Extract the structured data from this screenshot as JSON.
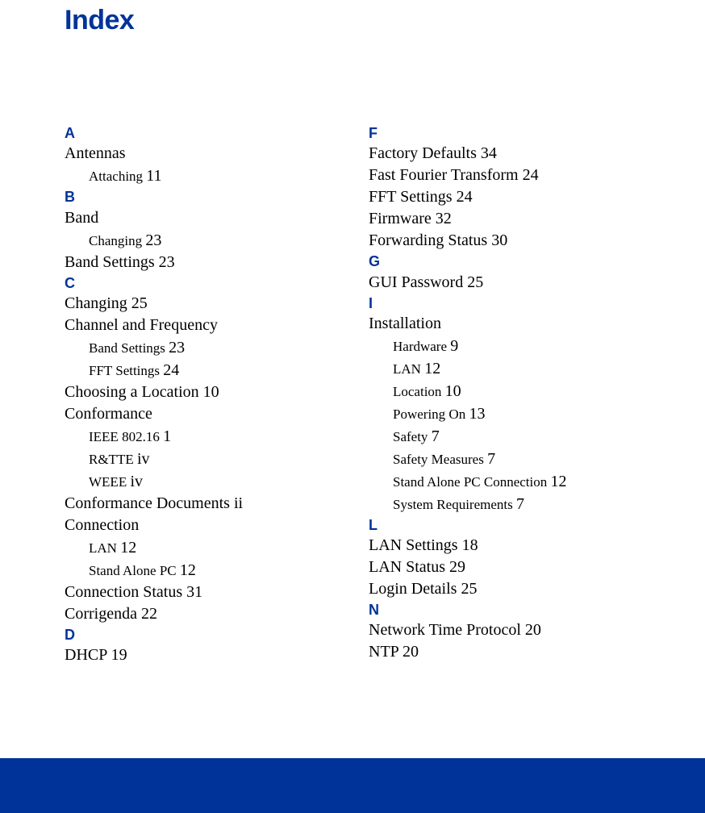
{
  "title": "Index",
  "columns": {
    "left": [
      {
        "kind": "letter",
        "text": "A"
      },
      {
        "kind": "entry",
        "text": "Antennas"
      },
      {
        "kind": "sub",
        "text": "Attaching",
        "page": "11"
      },
      {
        "kind": "letter",
        "text": "B"
      },
      {
        "kind": "entry",
        "text": "Band"
      },
      {
        "kind": "sub",
        "text": "Changing",
        "page": "23"
      },
      {
        "kind": "entry",
        "text": "Band Settings",
        "page": "23"
      },
      {
        "kind": "letter",
        "text": "C"
      },
      {
        "kind": "entry",
        "text": "Changing",
        "page": "25"
      },
      {
        "kind": "entry",
        "text": "Channel and Frequency"
      },
      {
        "kind": "sub",
        "text": "Band Settings",
        "page": "23"
      },
      {
        "kind": "sub",
        "text": "FFT Settings",
        "page": "24"
      },
      {
        "kind": "entry",
        "text": "Choosing a Location",
        "page": "10"
      },
      {
        "kind": "entry",
        "text": "Conformance"
      },
      {
        "kind": "sub",
        "text": "IEEE 802.16",
        "page": "1"
      },
      {
        "kind": "sub",
        "text": "R&TTE",
        "page": "iv"
      },
      {
        "kind": "sub",
        "text": "WEEE",
        "page": "iv"
      },
      {
        "kind": "entry",
        "text": "Conformance Documents",
        "page": "ii"
      },
      {
        "kind": "entry",
        "text": "Connection"
      },
      {
        "kind": "sub",
        "text": "LAN",
        "page": "12"
      },
      {
        "kind": "sub",
        "text": "Stand Alone PC",
        "page": "12"
      },
      {
        "kind": "entry",
        "text": "Connection Status",
        "page": "31"
      },
      {
        "kind": "entry",
        "text": "Corrigenda",
        "page": "22"
      },
      {
        "kind": "letter",
        "text": "D"
      },
      {
        "kind": "entry",
        "text": "DHCP",
        "page": "19"
      }
    ],
    "right": [
      {
        "kind": "letter",
        "text": "F"
      },
      {
        "kind": "entry",
        "text": "Factory Defaults",
        "page": "34"
      },
      {
        "kind": "entry",
        "text": "Fast Fourier Transform",
        "page": "24"
      },
      {
        "kind": "entry",
        "text": "FFT Settings",
        "page": "24"
      },
      {
        "kind": "entry",
        "text": "Firmware",
        "page": "32"
      },
      {
        "kind": "entry",
        "text": "Forwarding Status",
        "page": "30"
      },
      {
        "kind": "letter",
        "text": "G"
      },
      {
        "kind": "entry",
        "text": "GUI Password",
        "page": "25"
      },
      {
        "kind": "letter",
        "text": "I"
      },
      {
        "kind": "entry",
        "text": "Installation"
      },
      {
        "kind": "sub",
        "text": "Hardware",
        "page": "9"
      },
      {
        "kind": "sub",
        "text": "LAN",
        "page": "12"
      },
      {
        "kind": "sub",
        "text": "Location",
        "page": "10"
      },
      {
        "kind": "sub",
        "text": "Powering On",
        "page": "13"
      },
      {
        "kind": "sub",
        "text": "Safety",
        "page": "7"
      },
      {
        "kind": "sub",
        "text": "Safety Measures",
        "page": "7"
      },
      {
        "kind": "sub",
        "text": "Stand Alone PC Connection",
        "page": "12"
      },
      {
        "kind": "sub",
        "text": "System Requirements",
        "page": "7"
      },
      {
        "kind": "letter",
        "text": "L"
      },
      {
        "kind": "entry",
        "text": "LAN Settings",
        "page": "18"
      },
      {
        "kind": "entry",
        "text": "LAN Status",
        "page": "29"
      },
      {
        "kind": "entry",
        "text": "Login Details",
        "page": "25"
      },
      {
        "kind": "letter",
        "text": "N"
      },
      {
        "kind": "entry",
        "text": "Network Time Protocol",
        "page": "20"
      },
      {
        "kind": "entry",
        "text": "NTP",
        "page": "20"
      }
    ]
  }
}
